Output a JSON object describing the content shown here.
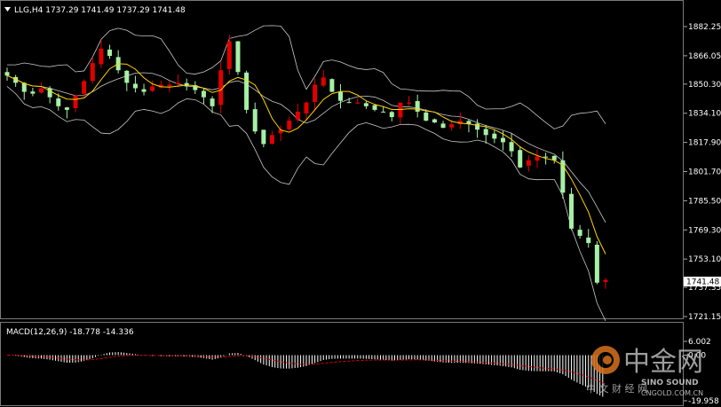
{
  "header": {
    "symbol_line": "LLG,H4  1737.29 1741.49 1737.29 1741.48"
  },
  "macd_header": {
    "label": "MACD(12,26,9) -18.778 -14.336"
  },
  "watermark": {
    "logo_text": "中金网",
    "sub_text": "中 文 财 经 网",
    "brand": "SINO SOUND",
    "site": "CNGOLD.COM.CN"
  },
  "colors": {
    "background": "#000000",
    "bull": "#e00000",
    "bear": "#a6f0a6",
    "ma_fast": "#ffd400",
    "bands": "#c8c8c8",
    "macd_hist": "#ffffff",
    "macd_signal": "#e00000"
  },
  "chart_data": [
    {
      "type": "candlestick",
      "symbol": "LLG",
      "timeframe": "H4",
      "ohlc_current": {
        "open": 1737.29,
        "high": 1741.49,
        "low": 1737.29,
        "close": 1741.48
      },
      "y_ticks": [
        1882.25,
        1866.05,
        1850.3,
        1834.1,
        1817.9,
        1801.7,
        1785.5,
        1769.3,
        1753.1,
        1737.35,
        1721.15
      ],
      "ylim": [
        1721.15,
        1882.25
      ],
      "price_label": "1741.48",
      "close_path": [
        1855,
        1851,
        1846,
        1845,
        1848,
        1843,
        1838,
        1836,
        1844,
        1852,
        1862,
        1870,
        1866,
        1858,
        1851,
        1848,
        1846,
        1849,
        1850,
        1850,
        1851,
        1849,
        1847,
        1843,
        1838,
        1858,
        1874,
        1857,
        1836,
        1824,
        1817,
        1822,
        1825,
        1830,
        1835,
        1840,
        1850,
        1854,
        1846,
        1841,
        1840,
        1840,
        1838,
        1836,
        1835,
        1832,
        1840,
        1840,
        1835,
        1830,
        1829,
        1826,
        1828,
        1830,
        1828,
        1825,
        1822,
        1820,
        1818,
        1813,
        1804,
        1808,
        1810,
        1810,
        1808,
        1790,
        1770,
        1766,
        1762,
        1740,
        1741.48
      ],
      "overlays": [
        "Bollinger Bands",
        "Moving Average"
      ]
    },
    {
      "type": "bar",
      "name": "MACD(12,26,9)",
      "main_value": -18.778,
      "signal_value": -14.336,
      "y_ticks": [
        "6.002",
        "0.00",
        "-19.958"
      ],
      "ylim": [
        -19.958,
        6.002
      ]
    }
  ]
}
